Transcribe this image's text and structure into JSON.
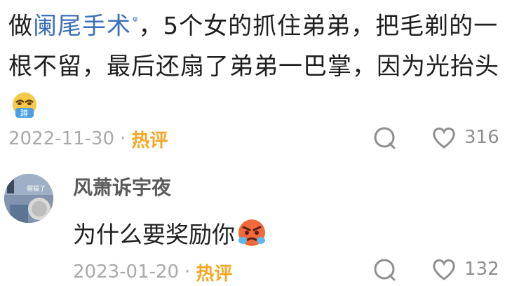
{
  "post": {
    "text_before_link": "做",
    "link_text": "阑尾手术",
    "link_icon": "search-icon",
    "text_after_link": "，5个女的抓住弟弟，把毛剃的一根不留，最后还扇了弟弟一巴掌，因为光抬头",
    "trailing_emoji": "squat-emoji",
    "emoji_label": "蹲",
    "date": "2022-11-30",
    "separator": "·",
    "hot_label": "热评",
    "like_count": "316"
  },
  "reply": {
    "username": "风萧诉宇夜",
    "avatar_label": "帽猫了",
    "text": "为什么要奖励你",
    "trailing_emoji": "angry-crying-emoji",
    "date": "2023-01-20",
    "separator": "·",
    "hot_label": "热评",
    "like_count": "132"
  },
  "colors": {
    "link": "#3b6fb8",
    "hot": "#f5a623",
    "meta": "#a9a9a9",
    "text": "#1f1f1f"
  }
}
